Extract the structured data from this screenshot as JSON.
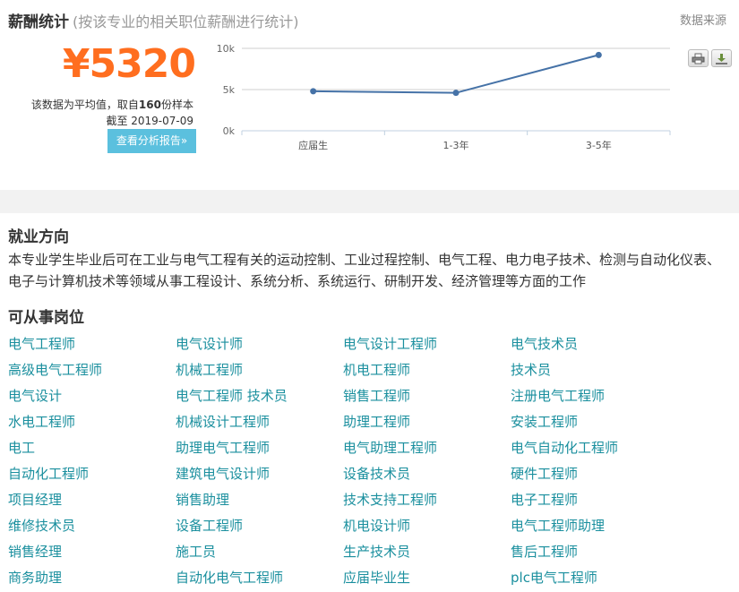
{
  "salary": {
    "title": "薪酬统计",
    "subtitle": "(按该专业的相关职位薪酬进行统计)",
    "data_source": "数据来源",
    "amount": "¥5320",
    "note_prefix": "该数据为平均值，取自",
    "sample_count": "160",
    "note_suffix": "份样本",
    "date_text": "截至 2019-07-09",
    "report_button": "查看分析报告»"
  },
  "chart_data": {
    "type": "line",
    "categories": [
      "应届生",
      "1-3年",
      "3-5年"
    ],
    "values": [
      4800,
      4600,
      9200
    ],
    "ylim": [
      0,
      10000
    ],
    "yticks": [
      0,
      5000,
      10000
    ],
    "ytick_labels": [
      "0k",
      "5k",
      "10k"
    ],
    "grid": true,
    "line_color": "#4572a7"
  },
  "career": {
    "title": "就业方向",
    "description": "本专业学生毕业后可在工业与电气工程有关的运动控制、工业过程控制、电气工程、电力电子技术、检测与自动化仪表、电子与计算机技术等领域从事工程设计、系统分析、系统运行、研制开发、经济管理等方面的工作"
  },
  "jobs": {
    "title": "可从事岗位",
    "items": [
      "电气工程师",
      "电气设计师",
      "电气设计工程师",
      "电气技术员",
      "高级电气工程师",
      "机械工程师",
      "机电工程师",
      "技术员",
      "电气设计",
      "电气工程师 技术员",
      "销售工程师",
      "注册电气工程师",
      "水电工程师",
      "机械设计工程师",
      "助理工程师",
      "安装工程师",
      "电工",
      "助理电气工程师",
      "电气助理工程师",
      "电气自动化工程师",
      "自动化工程师",
      "建筑电气设计师",
      "设备技术员",
      "硬件工程师",
      "项目经理",
      "销售助理",
      "技术支持工程师",
      "电子工程师",
      "维修技术员",
      "设备工程师",
      "机电设计师",
      "电气工程师助理",
      "销售经理",
      "施工员",
      "生产技术员",
      "售后工程师",
      "商务助理",
      "自动化电气工程师",
      "应届毕业生",
      "plc电气工程师"
    ]
  }
}
